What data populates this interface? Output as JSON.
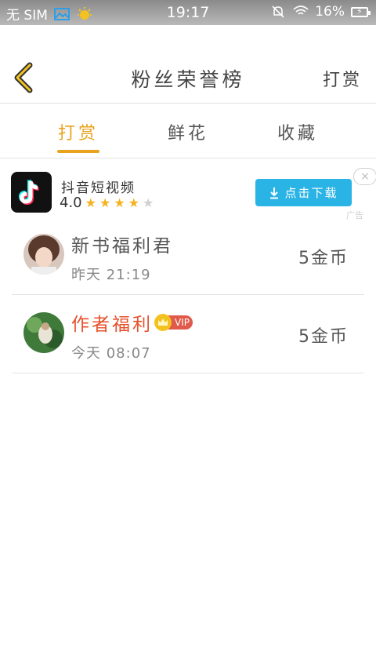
{
  "statusbar": {
    "carrier": "无 SIM",
    "time": "19:17",
    "battery": "16%"
  },
  "header": {
    "title": "粉丝荣誉榜",
    "action": "打赏"
  },
  "tabs": [
    {
      "label": "打赏"
    },
    {
      "label": "鲜花"
    },
    {
      "label": "收藏"
    }
  ],
  "ad": {
    "app_name": "抖音短视频",
    "rating": "4.0",
    "download_label": "点击下载",
    "close_icon": "×",
    "tag": "广告"
  },
  "list": [
    {
      "name": "新书福利君",
      "when": "昨天 21:19",
      "amount": "5金币",
      "vip": false
    },
    {
      "name": "作者福利",
      "when": "今天 08:07",
      "amount": "5金币",
      "vip": true,
      "vip_label": "VIP"
    }
  ],
  "colors": {
    "accent": "#e8a31c",
    "download": "#2ab3e5",
    "vip_name": "#e5512c"
  }
}
